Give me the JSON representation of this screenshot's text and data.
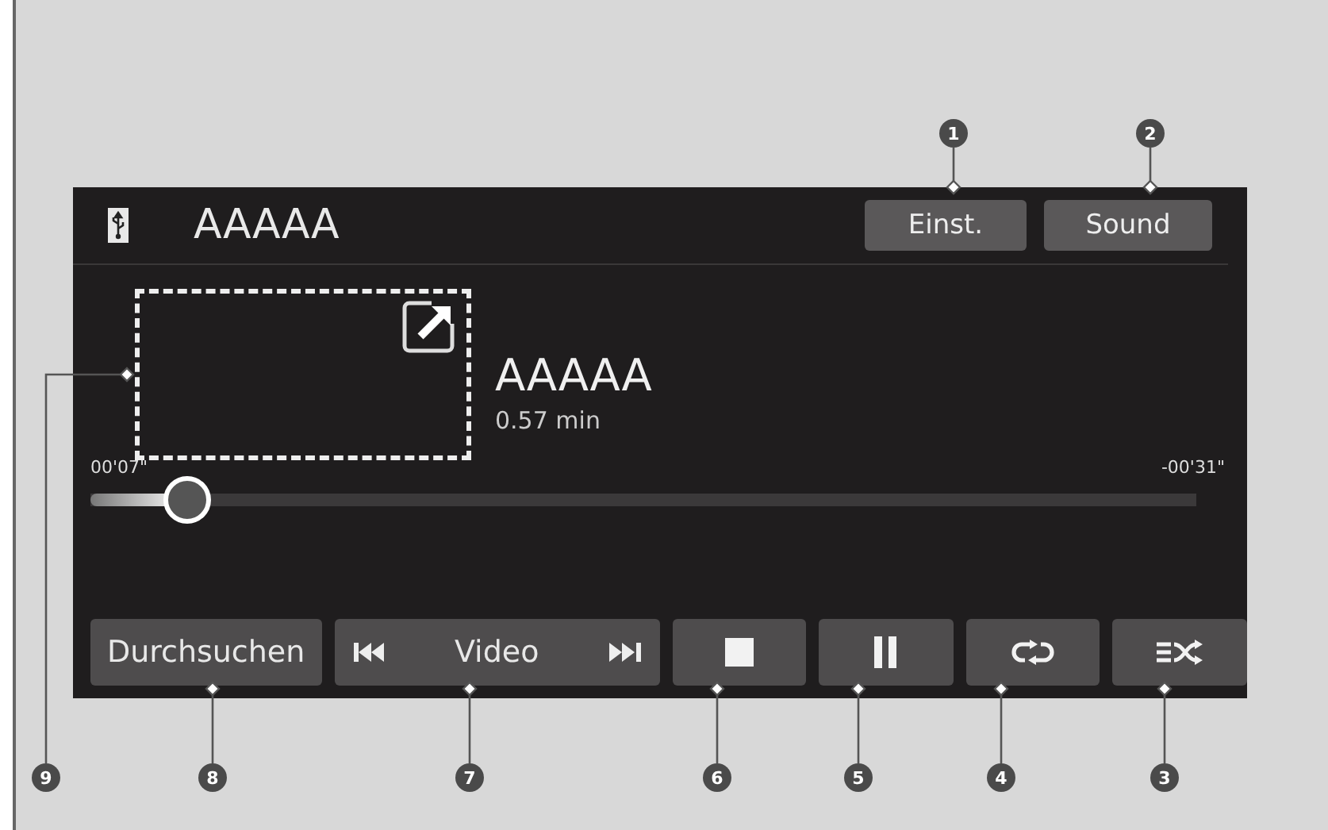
{
  "screen": {
    "source_title": "AAAAA",
    "top_buttons": [
      {
        "label": "Einst."
      },
      {
        "label": "Sound"
      }
    ],
    "track": {
      "title": "AAAAA",
      "duration": "0.57 min"
    },
    "progress": {
      "elapsed": "00'07\"",
      "remaining": "-00'31\"",
      "level": 0.088
    },
    "controls": [
      {
        "kind": "text",
        "label": "Durchsuchen"
      },
      {
        "kind": "source",
        "label": "Video"
      },
      {
        "kind": "stop"
      },
      {
        "kind": "pause"
      },
      {
        "kind": "repeat"
      },
      {
        "kind": "shuffle"
      }
    ]
  },
  "callouts": [
    "1",
    "2",
    "9",
    "8",
    "7",
    "6",
    "5",
    "4",
    "3"
  ]
}
